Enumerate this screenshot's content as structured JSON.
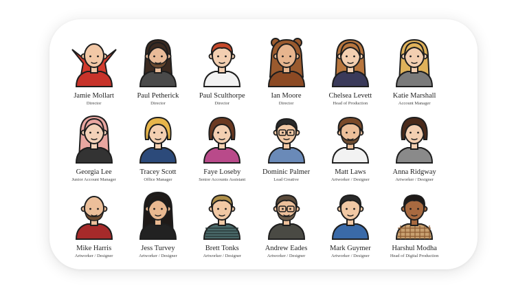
{
  "team": [
    {
      "name": "Jamie Mollart",
      "role": "Director",
      "icon": "wizard-avatar-icon",
      "skin": "#f2c8a6",
      "hair": "bald",
      "hairColor": "#8a3b1f",
      "shirt": "#c7332a",
      "extra": "cape"
    },
    {
      "name": "Paul Petherick",
      "role": "Director",
      "icon": "jedi-avatar-icon",
      "skin": "#e9bb98",
      "hair": "long",
      "hairColor": "#3b2a20",
      "shirt": "#4a4a4a",
      "extra": "beard"
    },
    {
      "name": "Paul Sculthorpe",
      "role": "Director",
      "icon": "redhead-avatar-icon",
      "skin": "#f3cfb1",
      "hair": "short",
      "hairColor": "#c5482a",
      "shirt": "#f2f2f2",
      "extra": "none"
    },
    {
      "name": "Ian Moore",
      "role": "Director",
      "icon": "bear-hood-avatar-icon",
      "skin": "#e7b58e",
      "hair": "hood",
      "hairColor": "#9a5a2e",
      "shirt": "#8c4a24",
      "extra": "none"
    },
    {
      "name": "Chelsea Levett",
      "role": "Head of Production",
      "icon": "long-hair-woman-avatar-icon",
      "skin": "#f3cfb1",
      "hair": "longf",
      "hairColor": "#b8763e",
      "shirt": "#3a3a5a",
      "extra": "none"
    },
    {
      "name": "Katie Marshall",
      "role": "Account Manager",
      "icon": "blonde-woman-avatar-icon",
      "skin": "#f3cfb1",
      "hair": "longf",
      "hairColor": "#e0b25a",
      "shirt": "#7a7a7a",
      "extra": "none"
    },
    {
      "name": "Georgia Lee",
      "role": "Junior Account Manager",
      "icon": "pink-hair-woman-avatar-icon",
      "skin": "#f3d1b8",
      "hair": "longf",
      "hairColor": "#e9a6a0",
      "shirt": "#333333",
      "extra": "none"
    },
    {
      "name": "Tracey Scott",
      "role": "Office Manager",
      "icon": "blonde-bob-avatar-icon",
      "skin": "#f3cfb1",
      "hair": "bob",
      "hairColor": "#e7b54a",
      "shirt": "#2c4a7a",
      "extra": "none"
    },
    {
      "name": "Faye Loseby",
      "role": "Senior Accounts Assistant",
      "icon": "ponytail-woman-avatar-icon",
      "skin": "#f3cfb1",
      "hair": "bob",
      "hairColor": "#6b3a22",
      "shirt": "#b94a8a",
      "extra": "none"
    },
    {
      "name": "Dominic Palmer",
      "role": "Lead Creative",
      "icon": "glasses-man-avatar-icon",
      "skin": "#f1c8a4",
      "hair": "short",
      "hairColor": "#2a2a2a",
      "shirt": "#6a8ab8",
      "extra": "glasses"
    },
    {
      "name": "Matt Laws",
      "role": "Artworker / Designer",
      "icon": "curly-beard-avatar-icon",
      "skin": "#ecbf9a",
      "hair": "curly",
      "hairColor": "#7a4a2a",
      "shirt": "#f2f2f2",
      "extra": "beard"
    },
    {
      "name": "Anna Ridgway",
      "role": "Artworker / Designer",
      "icon": "brunette-woman-avatar-icon",
      "skin": "#f3cfb1",
      "hair": "bob",
      "hairColor": "#4a2a1a",
      "shirt": "#8a8a8a",
      "extra": "none"
    },
    {
      "name": "Mike Harris",
      "role": "Artworker / Designer",
      "icon": "bald-beard-avatar-icon",
      "skin": "#ecbf9a",
      "hair": "bald",
      "hairColor": "#ecbf9a",
      "shirt": "#a62a2a",
      "extra": "beard"
    },
    {
      "name": "Jess Turvey",
      "role": "Artworker / Designer",
      "icon": "dark-hair-woman-avatar-icon",
      "skin": "#e9b890",
      "hair": "longf",
      "hairColor": "#1f1a18",
      "shirt": "#222222",
      "extra": "none"
    },
    {
      "name": "Brett Tonks",
      "role": "Artworker / Designer",
      "icon": "striped-shirt-avatar-icon",
      "skin": "#f1c8a4",
      "hair": "short",
      "hairColor": "#b0904a",
      "shirt": "#4a6a6a",
      "extra": "stripes"
    },
    {
      "name": "Andrew Eades",
      "role": "Artworker / Designer",
      "icon": "glasses-beard-avatar-icon",
      "skin": "#ecbf9a",
      "hair": "short",
      "hairColor": "#5a4a3a",
      "shirt": "#4a4a44",
      "extra": "glassesbeard"
    },
    {
      "name": "Mark Guymer",
      "role": "Artworker / Designer",
      "icon": "denim-shirt-avatar-icon",
      "skin": "#f1c8a4",
      "hair": "short",
      "hairColor": "#2a2a2a",
      "shirt": "#3a6aa8",
      "extra": "none"
    },
    {
      "name": "Harshul Modha",
      "role": "Head of Digital Production",
      "icon": "check-shirt-avatar-icon",
      "skin": "#a86a40",
      "hair": "short",
      "hairColor": "#1f1a18",
      "shirt": "#c8a070",
      "extra": "check"
    }
  ],
  "colors": {
    "outline": "#1e1e1e",
    "card": "#ffffff"
  }
}
